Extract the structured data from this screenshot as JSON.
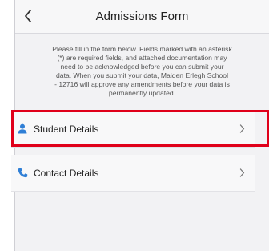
{
  "header": {
    "title": "Admissions Form",
    "back_icon": "chevron-left-icon"
  },
  "intro": {
    "lines": [
      "Please fill in the form below. Fields marked with an asterisk",
      "(*) are required fields, and attached documentation may",
      "need to be acknowledged before you can submit your",
      "data. When you submit your data, Maiden Erlegh School",
      "- 12716 will approve any amendments before your data is",
      "permanently updated."
    ]
  },
  "sections": [
    {
      "label": "Student Details",
      "icon": "person-icon",
      "highlighted": true
    },
    {
      "label": "Contact Details",
      "icon": "phone-icon",
      "highlighted": false
    }
  ],
  "colors": {
    "accent": "#2f7fd6",
    "highlight": "#e0001a",
    "background": "#f2f2f4"
  }
}
